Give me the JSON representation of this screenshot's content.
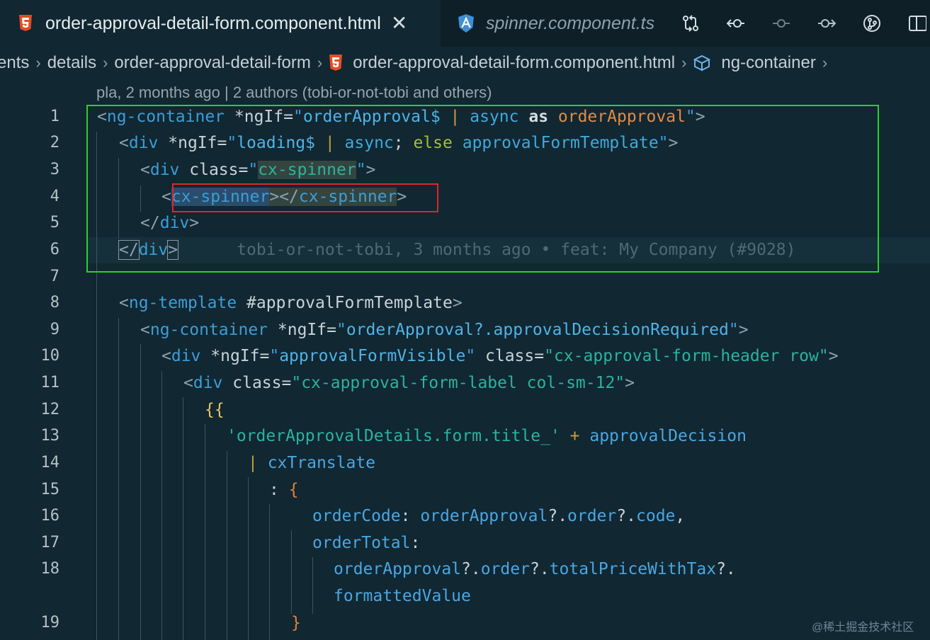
{
  "tabs": [
    {
      "label": "order-approval-detail-form.component.html",
      "icon": "html5-icon",
      "active": true
    },
    {
      "label": "spinner.component.ts",
      "icon": "angular-icon",
      "active": false
    }
  ],
  "actions": [
    "compare-changes-icon",
    "previous-change-icon",
    "current-commit-icon",
    "next-change-icon",
    "git-graph-icon",
    "split-editor-icon"
  ],
  "breadcrumb": [
    {
      "label": "ents"
    },
    {
      "label": "details"
    },
    {
      "label": "order-approval-detail-form"
    },
    {
      "label": "order-approval-detail-form.component.html",
      "icon": "html5-icon"
    },
    {
      "label": "ng-container",
      "icon": "cube-icon"
    }
  ],
  "editor": {
    "blame_header": "pla, 2 months ago | 2 authors (tobi-or-not-tobi and others)",
    "inline_blame": "tobi-or-not-tobi, 3 months ago • feat: My Company (#9028)",
    "line_numbers": [
      "1",
      "2",
      "3",
      "4",
      "5",
      "6",
      "7",
      "8",
      "9",
      "10",
      "11",
      "12",
      "13",
      "14",
      "15",
      "16",
      "17",
      "18",
      "",
      "19"
    ],
    "lines": {
      "l1": {
        "t1": "<",
        "t2": "ng-container",
        "t3": " *ngIf=",
        "t4": "\"",
        "t5": "orderApproval$",
        "t6": " | ",
        "t7": "async",
        "t8": " as ",
        "t9": "orderApproval",
        "t10": "\"",
        "t11": ">"
      },
      "l2": {
        "t1": "<",
        "t2": "div",
        "t3": " *ngIf=",
        "t4": "\"",
        "t5": "loading$",
        "t6": " | ",
        "t7": "async",
        "t8": "; ",
        "t9": "else",
        "t10": " approvalFormTemplate",
        "t11": "\"",
        "t12": ">"
      },
      "l3": {
        "t1": "<",
        "t2": "div",
        "t3": " class=",
        "t4": "\"",
        "t5": "cx-spinner",
        "t6": "\"",
        "t7": ">"
      },
      "l4": {
        "t1": "<",
        "t2": "cx-spinner",
        "t3": "></",
        "t4": "cx-spinner",
        "t5": ">"
      },
      "l5": {
        "t1": "</",
        "t2": "div",
        "t3": ">"
      },
      "l6": {
        "t1": "</",
        "t2": "div",
        "t3": ">"
      },
      "l8": {
        "t1": "<",
        "t2": "ng-template",
        "t3": " #approvalFormTemplate",
        "t4": ">"
      },
      "l9": {
        "t1": "<",
        "t2": "ng-container",
        "t3": " *ngIf=",
        "t4": "\"",
        "t5": "orderApproval?.approvalDecisionRequired",
        "t6": "\"",
        "t7": ">"
      },
      "l10": {
        "t1": "<",
        "t2": "div",
        "t3": " *ngIf=",
        "t4": "\"",
        "t5": "approvalFormVisible",
        "t6": "\"",
        "t7": " class=",
        "t8": "\"cx-approval-form-header row\"",
        "t9": ">"
      },
      "l11": {
        "t1": "<",
        "t2": "div",
        "t3": " class=",
        "t4": "\"cx-approval-form-label col-sm-12\"",
        "t5": ">"
      },
      "l12": {
        "t1": "{{"
      },
      "l13": {
        "t1": "'orderApprovalDetails.form.title_'",
        "t2": " + ",
        "t3": "approvalDecision"
      },
      "l14": {
        "t1": "| ",
        "t2": "cxTranslate"
      },
      "l15": {
        "t1": ": ",
        "t2": "{"
      },
      "l16": {
        "t1": "orderCode",
        "t2": ": ",
        "t3": "orderApproval",
        "t4": "?.",
        "t5": "order",
        "t6": "?.",
        "t7": "code",
        "t8": ","
      },
      "l17": {
        "t1": "orderTotal",
        "t2": ":"
      },
      "l18": {
        "t1": "orderApproval",
        "t2": "?.",
        "t3": "order",
        "t4": "?.",
        "t5": "totalPriceWithTax",
        "t6": "?."
      },
      "l18b": {
        "t1": "formattedValue"
      },
      "l19": {
        "t1": "}"
      }
    }
  },
  "watermark": "@稀土掘金技术社区",
  "colors": {
    "highlight_green": "#2ad12a",
    "highlight_red": "#e0242e",
    "background": "#112731"
  }
}
